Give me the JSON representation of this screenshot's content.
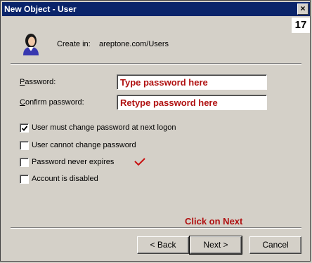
{
  "window": {
    "title": "New Object - User",
    "close_label": "×"
  },
  "step_badge": "17",
  "header": {
    "create_in_label": "Create in:",
    "create_in_path": "areptone.com/Users"
  },
  "fields": {
    "password_label": "Password:",
    "password_hint": "Type password here",
    "confirm_label": "Confirm password:",
    "confirm_hint": "Retype password here"
  },
  "options": [
    {
      "label": "User must change password at next logon",
      "checked": true
    },
    {
      "label": "User cannot change password",
      "checked": false
    },
    {
      "label": "Password never expires",
      "checked": false
    },
    {
      "label": "Account is disabled",
      "checked": false
    }
  ],
  "instruction": "Click on Next",
  "buttons": {
    "back": "< Back",
    "next": "Next >",
    "cancel": "Cancel"
  },
  "colors": {
    "titlebar": "#0a246a",
    "hint_red": "#b01010",
    "face": "#d4d0c8"
  },
  "icons": {
    "user": "user-icon",
    "tick": "red-checkmark-icon"
  }
}
